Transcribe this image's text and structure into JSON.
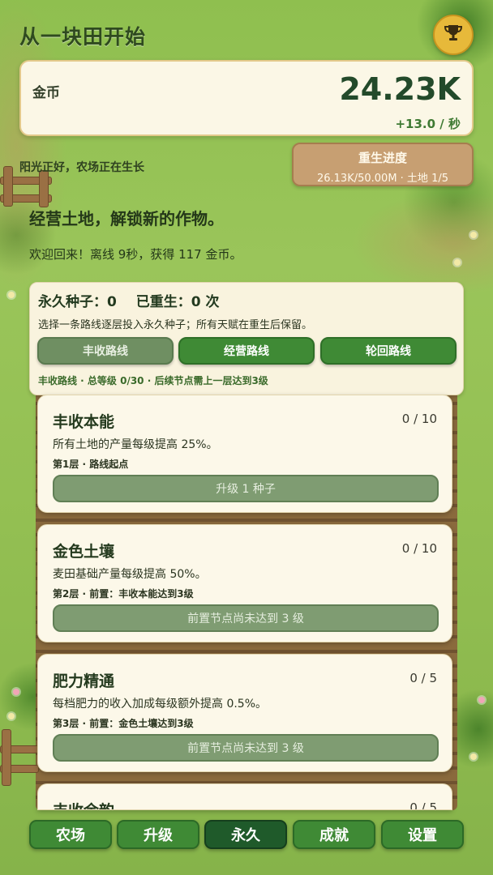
{
  "header": {
    "title": "从一块田开始"
  },
  "coins": {
    "label": "金币",
    "value": "24.23K",
    "rate": "+13.0 / 秒"
  },
  "status": {
    "text": "阳光正好，农场正在生长"
  },
  "rebirth": {
    "title": "重生进度",
    "detail": "26.13K/50.00M · 土地 1/5"
  },
  "intro": {
    "subtitle": "经营土地，解锁新的作物。",
    "welcome": "欢迎回来！离线 9秒，获得 117 金币。"
  },
  "permanent": {
    "seeds": "永久种子：0",
    "rebirths": "已重生：0 次",
    "description": "选择一条路线逐层投入永久种子；所有天赋在重生后保留。",
    "routes": [
      {
        "label": "丰收路线",
        "active": true
      },
      {
        "label": "经营路线",
        "active": false
      },
      {
        "label": "轮回路线",
        "active": false
      }
    ],
    "route_info": "丰收路线 · 总等级 0/30 · 后续节点需上一层达到3级"
  },
  "talents": [
    {
      "name": "丰收本能",
      "level": "0 / 10",
      "desc": "所有土地的产量每级提高 25%。",
      "req": "第1层 · 路线起点",
      "button": "升级 1 种子"
    },
    {
      "name": "金色土壤",
      "level": "0 / 10",
      "desc": "麦田基础产量每级提高 50%。",
      "req": "第2层 · 前置：丰收本能达到3级",
      "button": "前置节点尚未达到 3 级"
    },
    {
      "name": "肥力精通",
      "level": "0 / 5",
      "desc": "每档肥力的收入加成每级额外提高 0.5%。",
      "req": "第3层 · 前置：金色土壤达到3级",
      "button": "前置节点尚未达到 3 级"
    },
    {
      "name": "丰收余韵",
      "level": "0 / 5",
      "desc": "",
      "req": "",
      "button": ""
    }
  ],
  "nav": [
    {
      "label": "农场",
      "active": false
    },
    {
      "label": "升级",
      "active": false
    },
    {
      "label": "永久",
      "active": true
    },
    {
      "label": "成就",
      "active": false
    },
    {
      "label": "设置",
      "active": false
    }
  ],
  "icons": {
    "trophy": "trophy-icon"
  },
  "colors": {
    "accent_green": "#3f8a35",
    "active_nav": "#1f5a2a",
    "trophy_gold": "#e7b93a",
    "rebirth_box": "#c79f72"
  }
}
